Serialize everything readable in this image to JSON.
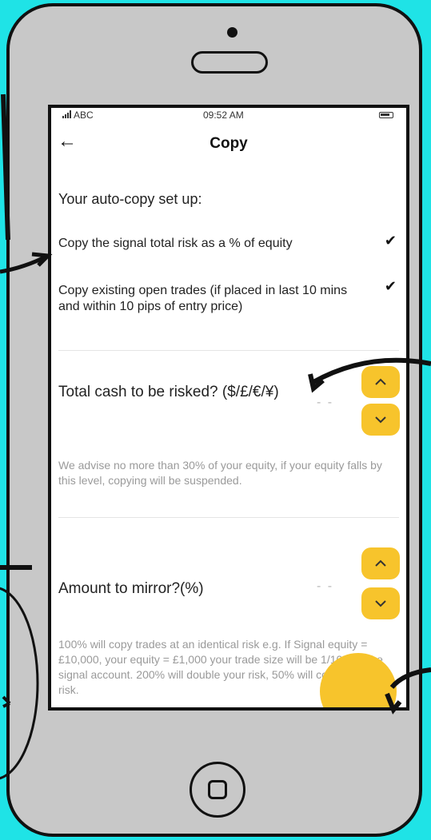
{
  "status_bar": {
    "carrier": "ABC",
    "time": "09:52 AM",
    "icons": [
      "signal-icon",
      "battery-icon"
    ]
  },
  "header": {
    "title": "Copy",
    "back_icon": "arrow-left-icon"
  },
  "setup": {
    "heading": "Your auto-copy set up:",
    "options": [
      {
        "label": "Copy the signal total risk as a % of equity",
        "checked": true
      },
      {
        "label": "Copy existing open trades (if placed in last 10 mins and within 10 pips of entry price)",
        "checked": true
      }
    ]
  },
  "cash_risk": {
    "label": "Total cash to be risked? ($/£/€/¥)",
    "value": "- -",
    "hint": "We advise no more than 30% of your equity, if your equity falls by this level, copying will be suspended."
  },
  "mirror": {
    "label": "Amount to mirror?(%)",
    "value": "- -",
    "hint": "100% will copy trades at an identical risk e.g. If Signal equity = £10,000, your equity = £1,000 your trade size will be 1/10th of the signal account. 200% will double your risk, 50% will copy at half the risk."
  },
  "colors": {
    "background": "#1fe3e6",
    "accent": "#f7c42c",
    "phone_body": "#c8c8c8"
  }
}
